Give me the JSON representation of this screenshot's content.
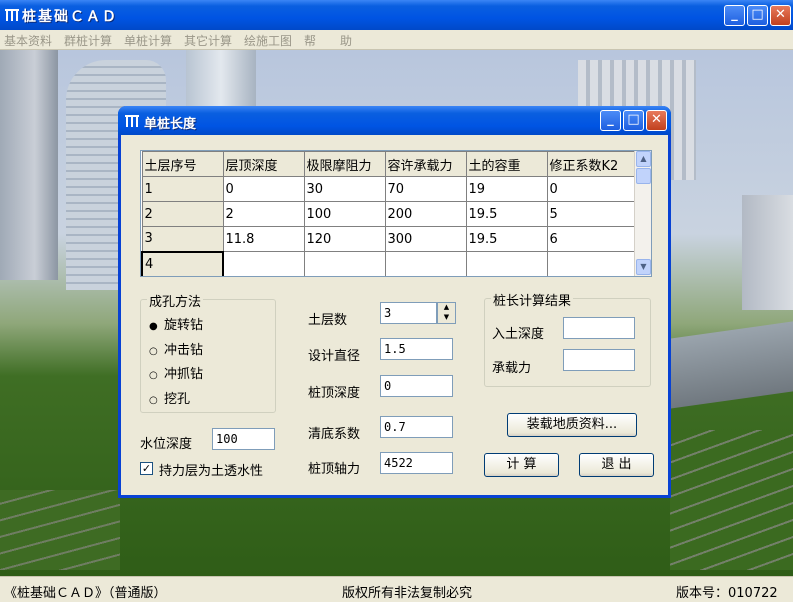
{
  "app": {
    "title": "桩基础ＣＡＤ"
  },
  "menu": [
    "基本资料",
    "群桩计算",
    "单桩计算",
    "其它计算",
    "绘施工图",
    "帮",
    "助"
  ],
  "status": {
    "left": "《桩基础ＣＡＤ》（普通版）",
    "center": "版权所有非法复制必究",
    "right": "版本号：010722"
  },
  "dialog": {
    "title": "单桩长度",
    "grid": {
      "headers": [
        "土层序号",
        "层顶深度",
        "极限摩阻力",
        "容许承载力",
        "土的容重",
        "修正系数K2"
      ],
      "rows": [
        [
          "1",
          "0",
          "30",
          "70",
          "19",
          "0"
        ],
        [
          "2",
          "2",
          "100",
          "200",
          "19.5",
          "5"
        ],
        [
          "3",
          "11.8",
          "120",
          "300",
          "19.5",
          "6"
        ],
        [
          "4",
          "",
          "",
          "",
          "",
          ""
        ]
      ]
    },
    "method": {
      "legend": "成孔方法",
      "options": [
        "旋转钻",
        "冲击钻",
        "冲抓钻",
        "挖孔"
      ],
      "selected": 0
    },
    "water_depth": {
      "label": "水位深度",
      "value": "100"
    },
    "bearing_check": {
      "label": "持力层为土透水性",
      "checked": true
    },
    "fields": {
      "soil_layers": {
        "label": "土层数",
        "value": "3"
      },
      "design_diameter": {
        "label": "设计直径",
        "value": "1.5"
      },
      "pile_top_depth": {
        "label": "桩顶深度",
        "value": "0"
      },
      "clear_bottom": {
        "label": "清底系数",
        "value": "0.7"
      },
      "axial_force": {
        "label": "桩顶轴力",
        "value": "4522"
      }
    },
    "result": {
      "legend": "桩长计算结果",
      "embed_depth": {
        "label": "入土深度",
        "value": ""
      },
      "capacity": {
        "label": "承载力",
        "value": ""
      }
    },
    "buttons": {
      "load": "装载地质资料...",
      "calc": "计  算",
      "exit": "退  出"
    }
  }
}
